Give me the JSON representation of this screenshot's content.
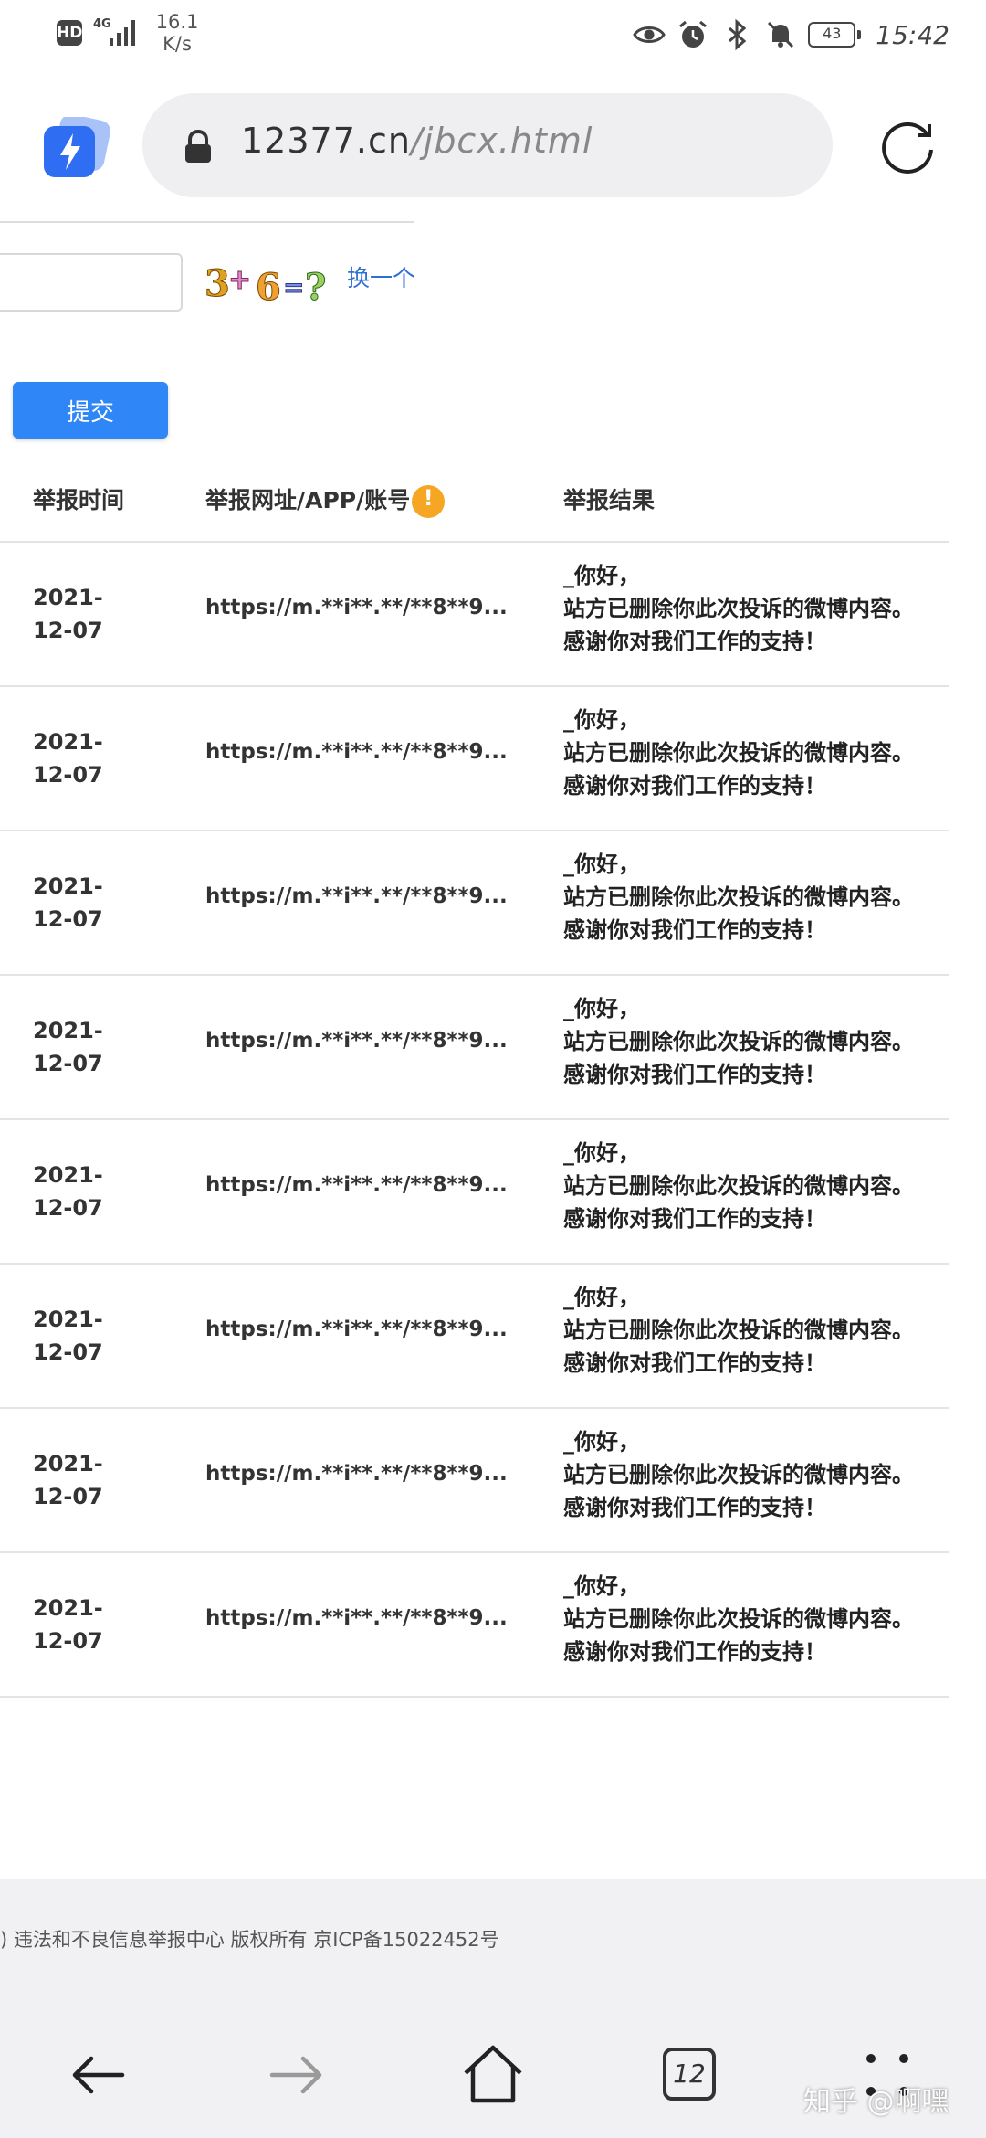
{
  "status_bar": {
    "hd": "HD",
    "network": "4G",
    "speed_value": "16.1",
    "speed_unit": "K/s",
    "battery": "43",
    "time": "15:42"
  },
  "browser": {
    "url_domain": "12377.cn",
    "url_path": "/jbcx.html"
  },
  "form": {
    "captcha_refresh": "换一个",
    "submit_label": "提交"
  },
  "table": {
    "headers": {
      "time": "举报时间",
      "url": "举报网址/APP/账号",
      "info_mark": "!",
      "result": "举报结果"
    },
    "rows": [
      {
        "date": "2021-12-07",
        "url": "https://m.**i**.**/**8**9...",
        "result": [
          "_你好，",
          "站方已删除你此次投诉的微博内容。",
          "感谢你对我们工作的支持！"
        ]
      },
      {
        "date": "2021-12-07",
        "url": "https://m.**i**.**/**8**9...",
        "result": [
          "_你好，",
          "站方已删除你此次投诉的微博内容。",
          "感谢你对我们工作的支持！"
        ]
      },
      {
        "date": "2021-12-07",
        "url": "https://m.**i**.**/**8**9...",
        "result": [
          "_你好，",
          "站方已删除你此次投诉的微博内容。",
          "感谢你对我们工作的支持！"
        ]
      },
      {
        "date": "2021-12-07",
        "url": "https://m.**i**.**/**8**9...",
        "result": [
          "_你好，",
          "站方已删除你此次投诉的微博内容。",
          "感谢你对我们工作的支持！"
        ]
      },
      {
        "date": "2021-12-07",
        "url": "https://m.**i**.**/**8**9...",
        "result": [
          "_你好，",
          "站方已删除你此次投诉的微博内容。",
          "感谢你对我们工作的支持！"
        ]
      },
      {
        "date": "2021-12-07",
        "url": "https://m.**i**.**/**8**9...",
        "result": [
          "_你好，",
          "站方已删除你此次投诉的微博内容。",
          "感谢你对我们工作的支持！"
        ]
      },
      {
        "date": "2021-12-07",
        "url": "https://m.**i**.**/**8**9...",
        "result": [
          "_你好，",
          "站方已删除你此次投诉的微博内容。",
          "感谢你对我们工作的支持！"
        ]
      },
      {
        "date": "2021-12-07",
        "url": "https://m.**i**.**/**8**9...",
        "result": [
          "_你好，",
          "站方已删除你此次投诉的微博内容。",
          "感谢你对我们工作的支持！"
        ]
      }
    ]
  },
  "footer": {
    "copyright": ") 违法和不良信息举报中心 版权所有 京ICP备15022452号"
  },
  "nav": {
    "tab_count": "12"
  },
  "watermark": "知乎 @啊嘿",
  "colors": {
    "accent": "#2f86f6",
    "link": "#2f70d6",
    "info_badge": "#f5a623"
  }
}
